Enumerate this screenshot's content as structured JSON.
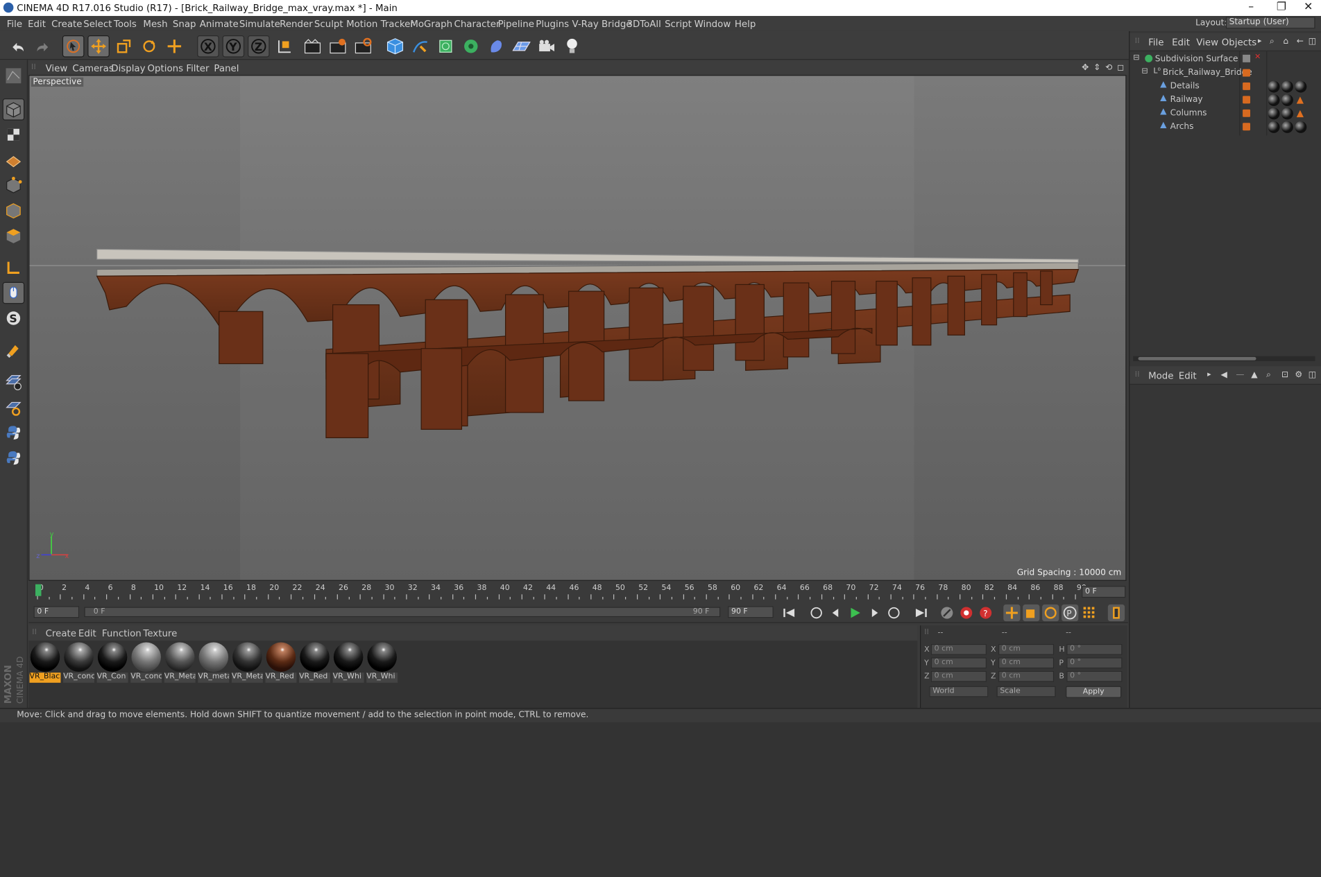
{
  "window": {
    "title": "CINEMA 4D R17.016 Studio (R17) - [Brick_Railway_Bridge_max_vray.max *] - Main",
    "min": "–",
    "max": "❐",
    "close": "✕"
  },
  "menu": [
    "File",
    "Edit",
    "Create",
    "Select",
    "Tools",
    "Mesh",
    "Snap",
    "Animate",
    "Simulate",
    "Render",
    "Sculpt",
    "Motion Tracker",
    "MoGraph",
    "Character",
    "Pipeline",
    "Plugins",
    "V-Ray Bridge",
    "3DToAll",
    "Script",
    "Window",
    "Help"
  ],
  "layout": {
    "label": "Layout:",
    "value": "Startup (User)"
  },
  "viewport_menu": [
    "View",
    "Cameras",
    "Display",
    "Options",
    "Filter",
    "Panel"
  ],
  "viewport": {
    "label": "Perspective",
    "grid": "Grid Spacing : 10000 cm"
  },
  "objects_menu": [
    "File",
    "Edit",
    "View",
    "Objects"
  ],
  "objects": [
    {
      "name": "Subdivision Surface",
      "indent": 0
    },
    {
      "name": "Brick_Railway_Bridge",
      "indent": 1
    },
    {
      "name": "Details",
      "indent": 2
    },
    {
      "name": "Railway",
      "indent": 2
    },
    {
      "name": "Columns",
      "indent": 2
    },
    {
      "name": "Archs",
      "indent": 2
    }
  ],
  "attr_menu": [
    "Mode",
    "Edit"
  ],
  "timeline": {
    "ticks": [
      "0",
      "2",
      "4",
      "6",
      "8",
      "10",
      "12",
      "14",
      "16",
      "18",
      "20",
      "22",
      "24",
      "26",
      "28",
      "30",
      "32",
      "34",
      "36",
      "38",
      "40",
      "42",
      "44",
      "46",
      "48",
      "50",
      "52",
      "54",
      "56",
      "58",
      "60",
      "62",
      "64",
      "66",
      "68",
      "70",
      "72",
      "74",
      "76",
      "78",
      "80",
      "82",
      "84",
      "86",
      "88",
      "90"
    ],
    "current": "0 F",
    "start": "0 F",
    "range_start": "0 F",
    "range_end": "90 F",
    "end": "90 F"
  },
  "mat_menu": [
    "Create",
    "Edit",
    "Function",
    "Texture"
  ],
  "materials": [
    "VR_Blac",
    "VR_conc",
    "VR_Con",
    "VR_conc",
    "VR_Meta",
    "VR_meta",
    "VR_Meta",
    "VR_Red",
    "VR_Red",
    "VR_Whi",
    "VR_Whi"
  ],
  "coords": {
    "hdr": [
      "--",
      "--",
      "--"
    ],
    "rows": [
      {
        "a": "X",
        "av": "0 cm",
        "b": "X",
        "bv": "0 cm",
        "c": "H",
        "cv": "0 °"
      },
      {
        "a": "Y",
        "av": "0 cm",
        "b": "Y",
        "bv": "0 cm",
        "c": "P",
        "cv": "0 °"
      },
      {
        "a": "Z",
        "av": "0 cm",
        "b": "Z",
        "bv": "0 cm",
        "c": "B",
        "cv": "0 °"
      }
    ],
    "world": "World",
    "scale": "Scale",
    "apply": "Apply"
  },
  "status": "Move: Click and drag to move elements. Hold down SHIFT to quantize movement / add to the selection in point mode, CTRL to remove.",
  "brand": "MAXON CINEMA 4D",
  "axis": {
    "x": "x",
    "y": "y",
    "z": "z"
  }
}
